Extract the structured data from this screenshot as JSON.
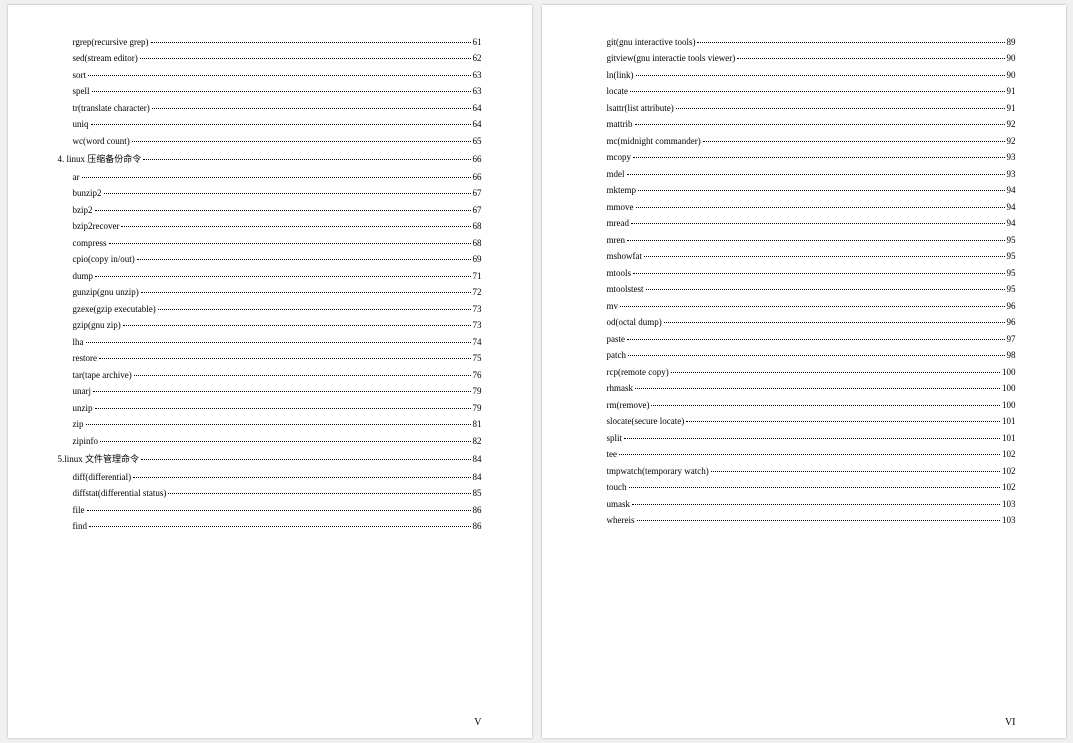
{
  "pages": [
    {
      "footer": "V",
      "entries": [
        {
          "label": "rgrep(recursive grep)",
          "page": "61",
          "indent": 2
        },
        {
          "label": "sed(stream editor)",
          "page": "62",
          "indent": 2
        },
        {
          "label": "sort",
          "page": "63",
          "indent": 2
        },
        {
          "label": "spell",
          "page": "63",
          "indent": 2
        },
        {
          "label": "tr(translate character)",
          "page": "64",
          "indent": 2
        },
        {
          "label": "uniq",
          "page": "64",
          "indent": 2
        },
        {
          "label": "wc(word count)",
          "page": "65",
          "indent": 2
        },
        {
          "label": "4. linux 压缩备份命令",
          "page": "66",
          "indent": 1
        },
        {
          "label": "ar",
          "page": "66",
          "indent": 2
        },
        {
          "label": "bunzip2",
          "page": "67",
          "indent": 2
        },
        {
          "label": "bzip2",
          "page": "67",
          "indent": 2
        },
        {
          "label": "bzip2recover",
          "page": "68",
          "indent": 2
        },
        {
          "label": "compress",
          "page": "68",
          "indent": 2
        },
        {
          "label": "cpio(copy in/out)",
          "page": "69",
          "indent": 2
        },
        {
          "label": "dump",
          "page": "71",
          "indent": 2
        },
        {
          "label": "gunzip(gnu unzip)",
          "page": "72",
          "indent": 2
        },
        {
          "label": "gzexe(gzip executable)",
          "page": "73",
          "indent": 2
        },
        {
          "label": "gzip(gnu zip)",
          "page": "73",
          "indent": 2
        },
        {
          "label": "lha",
          "page": "74",
          "indent": 2
        },
        {
          "label": "restore",
          "page": "75",
          "indent": 2
        },
        {
          "label": "tar(tape archive)",
          "page": "76",
          "indent": 2
        },
        {
          "label": "unarj",
          "page": "79",
          "indent": 2
        },
        {
          "label": "unzip",
          "page": "79",
          "indent": 2
        },
        {
          "label": "zip",
          "page": "81",
          "indent": 2
        },
        {
          "label": "zipinfo",
          "page": "82",
          "indent": 2
        },
        {
          "label": "5.linux 文件管理命令",
          "page": "84",
          "indent": 1
        },
        {
          "label": "diff(differential)",
          "page": "84",
          "indent": 2
        },
        {
          "label": "diffstat(differential status)",
          "page": "85",
          "indent": 2
        },
        {
          "label": "file",
          "page": "86",
          "indent": 2
        },
        {
          "label": "find",
          "page": "86",
          "indent": 2
        }
      ]
    },
    {
      "footer": "VI",
      "entries": [
        {
          "label": "git(gnu interactive tools)",
          "page": "89",
          "indent": 2
        },
        {
          "label": "gitview(gnu interactie tools viewer)",
          "page": "90",
          "indent": 2
        },
        {
          "label": "ln(link)",
          "page": "90",
          "indent": 2
        },
        {
          "label": "locate",
          "page": "91",
          "indent": 2
        },
        {
          "label": "lsattr(list attribute)",
          "page": "91",
          "indent": 2
        },
        {
          "label": "mattrib",
          "page": "92",
          "indent": 2
        },
        {
          "label": "mc(midnight commander)",
          "page": "92",
          "indent": 2
        },
        {
          "label": "mcopy",
          "page": "93",
          "indent": 2
        },
        {
          "label": "mdel",
          "page": "93",
          "indent": 2
        },
        {
          "label": "mktemp",
          "page": "94",
          "indent": 2
        },
        {
          "label": "mmove",
          "page": "94",
          "indent": 2
        },
        {
          "label": "mread",
          "page": "94",
          "indent": 2
        },
        {
          "label": "mren",
          "page": "95",
          "indent": 2
        },
        {
          "label": "mshowfat",
          "page": "95",
          "indent": 2
        },
        {
          "label": "mtools",
          "page": "95",
          "indent": 2
        },
        {
          "label": "mtoolstest",
          "page": "95",
          "indent": 2
        },
        {
          "label": "mv",
          "page": "96",
          "indent": 2
        },
        {
          "label": "od(octal dump)",
          "page": "96",
          "indent": 2
        },
        {
          "label": "paste",
          "page": "97",
          "indent": 2
        },
        {
          "label": "patch",
          "page": "98",
          "indent": 2
        },
        {
          "label": "rcp(remote copy)",
          "page": "100",
          "indent": 2
        },
        {
          "label": "rhmask",
          "page": "100",
          "indent": 2
        },
        {
          "label": "rm(remove)",
          "page": "100",
          "indent": 2
        },
        {
          "label": "slocate(secure locate)",
          "page": "101",
          "indent": 2
        },
        {
          "label": "split",
          "page": "101",
          "indent": 2
        },
        {
          "label": "tee",
          "page": "102",
          "indent": 2
        },
        {
          "label": "tmpwatch(temporary watch)",
          "page": "102",
          "indent": 2
        },
        {
          "label": "touch",
          "page": "102",
          "indent": 2
        },
        {
          "label": "umask",
          "page": "103",
          "indent": 2
        },
        {
          "label": "whereis",
          "page": "103",
          "indent": 2
        }
      ]
    }
  ]
}
